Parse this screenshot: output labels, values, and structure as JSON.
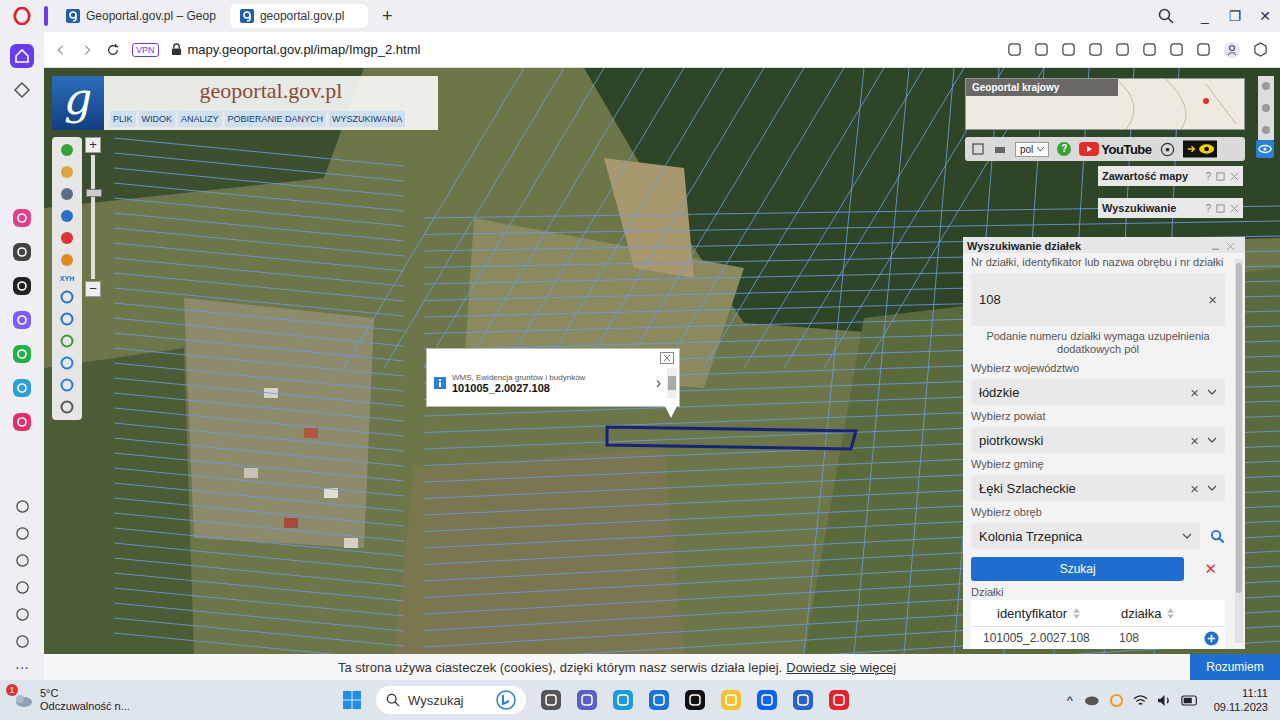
{
  "browser": {
    "tabs": [
      {
        "label": "Geoportal.gov.pl – Geop",
        "selected": false
      },
      {
        "label": "geoportal.gov.pl",
        "selected": true
      }
    ],
    "new_tab": "+",
    "window_controls": [
      "_",
      "❐",
      "✕"
    ],
    "vpn": "VPN",
    "url": "mapy.geoportal.gov.pl/imap/Imgp_2.html",
    "sidebar_more": "···"
  },
  "header": {
    "logo": "g",
    "title": "geoportal.gov.pl",
    "menu": [
      "PLIK",
      "WIDOK",
      "ANALIZY",
      "POBIERANIE DANYCH",
      "WYSZUKIWANIA"
    ]
  },
  "tools": {
    "xyh": "XYH",
    "zoom_in": "+",
    "zoom_out": "−",
    "zoom_level": 0.69
  },
  "overview": {
    "title": "Geoportal krajowy"
  },
  "map_toolbar": {
    "language": "pol",
    "help": "?",
    "youtube": "YouTube"
  },
  "panels": [
    {
      "title": "Zawartość mapy",
      "help": "?"
    },
    {
      "title": "Wyszukiwanie",
      "help": "?"
    }
  ],
  "popup": {
    "source": "WMS, Ewidencja gruntów i budynków",
    "id": "101005_2.0027.108",
    "next": "›"
  },
  "search": {
    "title": "Wyszukiwanie działek",
    "query_label": "Nr działki, identyfikator lub nazwa obrębu i nr działki",
    "query": "108",
    "clear": "×",
    "hint": "Podanie numeru działki wymaga uzupełnienia dodatkowych pól",
    "fields": [
      {
        "label": "Wybierz województwo",
        "value": "łódzkie",
        "kind": "select",
        "clearable": true
      },
      {
        "label": "Wybierz powiat",
        "value": "piotrkowski",
        "kind": "select",
        "clearable": true
      },
      {
        "label": "Wybierz gminę",
        "value": "Łęki Szlacheckie",
        "kind": "select",
        "clearable": true
      },
      {
        "label": "Wybierz obręb",
        "value": "Kolonia Trzepnica",
        "kind": "lookup",
        "clearable": false
      }
    ],
    "search_button": "Szukaj",
    "cancel": "✕",
    "results_label": "Działki",
    "columns": [
      "identyfikator",
      "działka"
    ],
    "rows": [
      {
        "cells": [
          "101005_2.0027.108",
          "108"
        ]
      }
    ]
  },
  "cookie": {
    "text": "Ta strona używa ciasteczek (cookies), dzięki którym nasz serwis działa lepiej.",
    "link": "Dowiedz się więcej",
    "button": "Rozumiem"
  },
  "taskbar": {
    "temp": "5°C",
    "desc": "Odczuwalność n...",
    "badge": "1",
    "search": "Wyszukaj",
    "tray_arrow": "^",
    "time": "11:11",
    "date": "09.11.2023"
  }
}
